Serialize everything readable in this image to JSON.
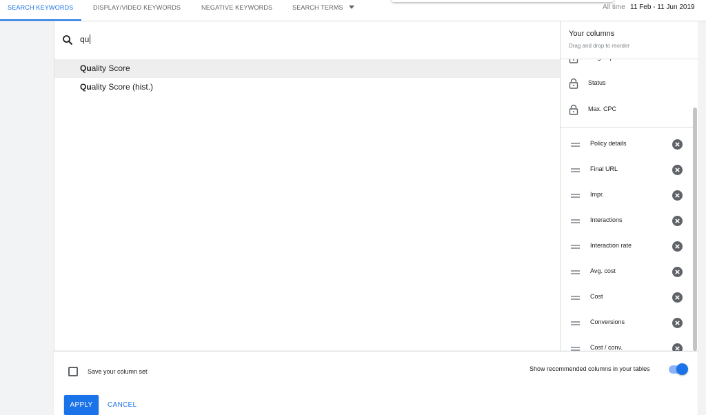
{
  "tabs": [
    {
      "label": "SEARCH KEYWORDS",
      "active": true
    },
    {
      "label": "DISPLAY/VIDEO KEYWORDS",
      "active": false
    },
    {
      "label": "NEGATIVE KEYWORDS",
      "active": false
    },
    {
      "label": "SEARCH TERMS",
      "active": false
    }
  ],
  "date": {
    "label": "All time",
    "range": "11 Feb - 11 Jun 2019"
  },
  "search": {
    "value": "qu"
  },
  "results": [
    {
      "match": "Qu",
      "rest": "ality Score"
    },
    {
      "match": "Qu",
      "rest": "ality Score (hist.)"
    }
  ],
  "columns_panel": {
    "title": "Your columns",
    "subtitle": "Drag and drop to reorder",
    "locked": [
      "Ad group",
      "Status",
      "Max. CPC"
    ],
    "items": [
      "Policy details",
      "Final URL",
      "Impr.",
      "Interactions",
      "Interaction rate",
      "Avg. cost",
      "Cost",
      "Conversions",
      "Cost / conv."
    ]
  },
  "footer": {
    "save_label": "Save your column set",
    "toggle_label": "Show recommended columns in your tables",
    "apply_label": "APPLY",
    "cancel_label": "CANCEL"
  },
  "colors": {
    "accent": "#1a73e8"
  }
}
